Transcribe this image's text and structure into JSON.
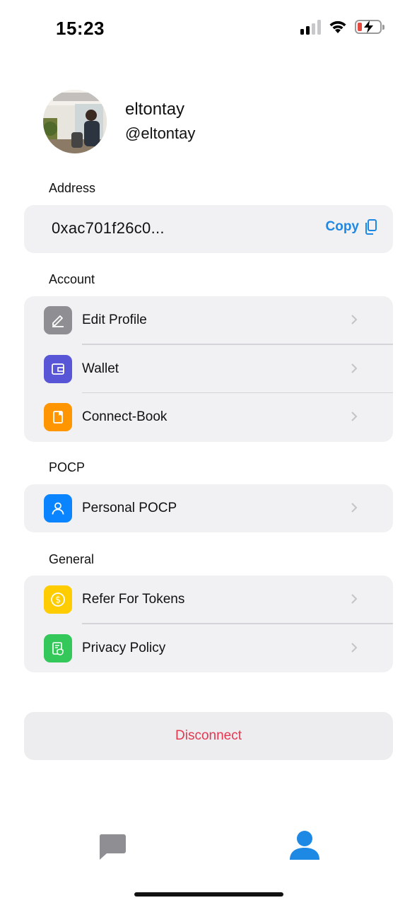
{
  "status_bar": {
    "time": "15:23",
    "icons": [
      "cellular-signal-icon",
      "wifi-icon",
      "battery-charging-icon"
    ]
  },
  "profile": {
    "display_name": "eltontay",
    "handle": "@eltontay"
  },
  "address_section": {
    "label": "Address",
    "address": "0xac701f26c0...",
    "copy_label": "Copy",
    "copy_icon": "copy-icon"
  },
  "account_section": {
    "label": "Account",
    "items": [
      {
        "label": "Edit Profile",
        "icon": "pencil-icon",
        "color": "#8e8e93"
      },
      {
        "label": "Wallet",
        "icon": "wallet-icon",
        "color": "#5856d6"
      },
      {
        "label": "Connect-Book",
        "icon": "book-icon",
        "color": "#ff9500"
      }
    ]
  },
  "pocp_section": {
    "label": "POCP",
    "items": [
      {
        "label": "Personal POCP",
        "icon": "person-icon",
        "color": "#0a84ff"
      }
    ]
  },
  "general_section": {
    "label": "General",
    "items": [
      {
        "label": "Refer For Tokens",
        "icon": "dollar-coin-icon",
        "color": "#ffcc00"
      },
      {
        "label": "Privacy Policy",
        "icon": "shield-document-icon",
        "color": "#34c759"
      }
    ]
  },
  "disconnect_label": "Disconnect",
  "tab_bar": {
    "tabs": [
      {
        "name": "chat",
        "icon": "chat-bubble-icon",
        "active": false
      },
      {
        "name": "profile",
        "icon": "person-icon",
        "active": true
      }
    ]
  },
  "colors": {
    "accent": "#1e88e5",
    "destructive": "#e5374f",
    "card_background": "#f1f1f4"
  }
}
